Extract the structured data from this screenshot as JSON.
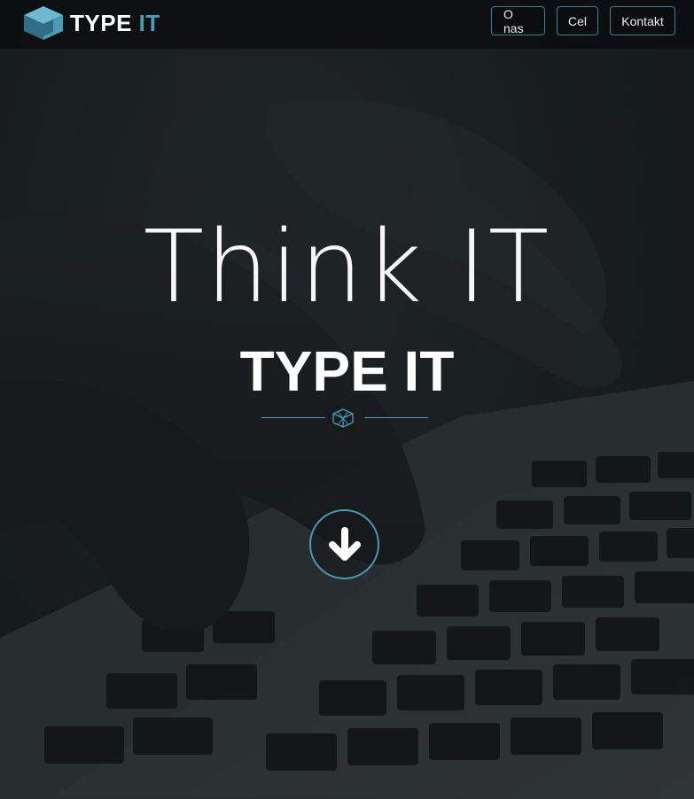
{
  "brand": {
    "logo_text_main": "TYPE ",
    "logo_text_accent": "IT",
    "logo_icon": "cube-logo-icon"
  },
  "nav": {
    "items": [
      {
        "label": "O nas"
      },
      {
        "label": "Cel"
      },
      {
        "label": "Kontakt"
      }
    ]
  },
  "hero": {
    "title": "Think IT",
    "subtitle": "TYPE IT",
    "divider_icon": "cube-outline-icon",
    "scroll_icon": "arrow-down-icon"
  },
  "colors": {
    "accent": "#4a9bb5",
    "navbar": "#0c0e0f",
    "text": "#ffffff"
  }
}
